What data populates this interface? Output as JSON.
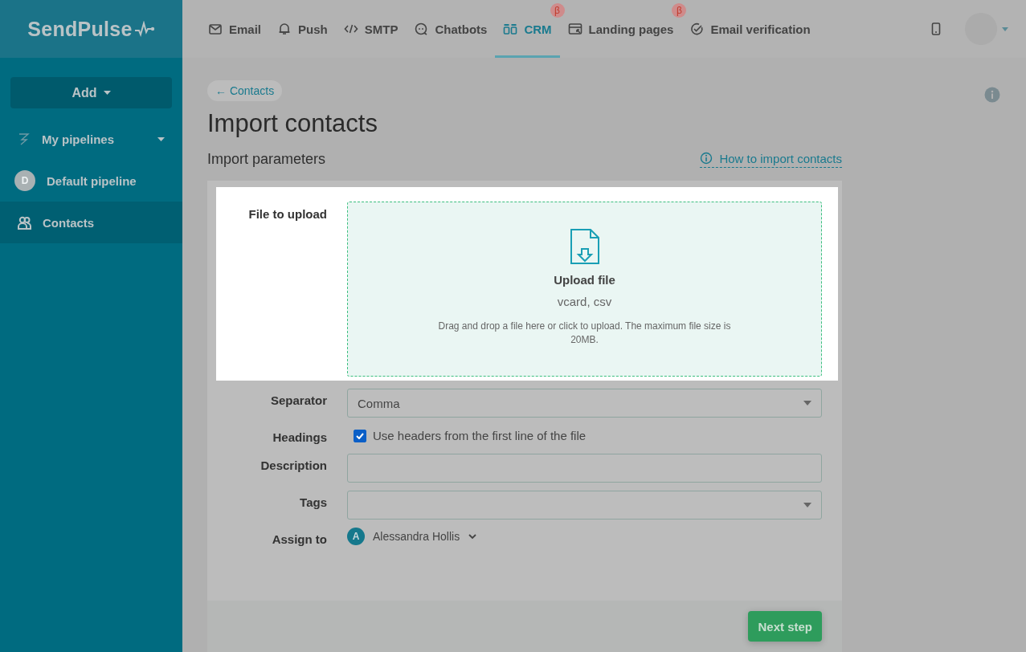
{
  "logo": "SendPulse",
  "nav": [
    {
      "label": "Email",
      "selected": false
    },
    {
      "label": "Push",
      "selected": false
    },
    {
      "label": "SMTP",
      "selected": false
    },
    {
      "label": "Chatbots",
      "selected": false
    },
    {
      "label": "CRM",
      "selected": true,
      "badge": "β"
    },
    {
      "label": "Landing pages",
      "selected": false,
      "badge": "β"
    },
    {
      "label": "Email verification",
      "selected": false
    }
  ],
  "sidebar": {
    "add_button": "Add",
    "items": [
      {
        "kind": "group",
        "label": "My pipelines",
        "selected": false
      },
      {
        "kind": "pipeline",
        "label": "Default pipeline",
        "avatar": "D",
        "selected": false
      },
      {
        "kind": "contacts",
        "label": "Contacts",
        "selected": true
      }
    ]
  },
  "breadcrumb": "← Contacts",
  "title": "Import contacts",
  "section_title": "Import parameters",
  "help_link": "How to import contacts",
  "upload": {
    "label": "File to upload",
    "title": "Upload file",
    "formats": "vcard, csv",
    "hint": "Drag and drop a file here or click to upload. The maximum file size is 20MB."
  },
  "fields": [
    {
      "kind": "select",
      "label": "Separator",
      "value": "Comma"
    },
    {
      "kind": "checkbox",
      "label": "Headings",
      "text": "Use headers from the first line of the file",
      "checked": true
    },
    {
      "kind": "text",
      "label": "Description"
    },
    {
      "kind": "select",
      "label": "Tags"
    },
    {
      "kind": "user",
      "label": "Assign to",
      "avatar": "A",
      "value": "Alessandra Hollis"
    }
  ],
  "next_button": "Next step"
}
